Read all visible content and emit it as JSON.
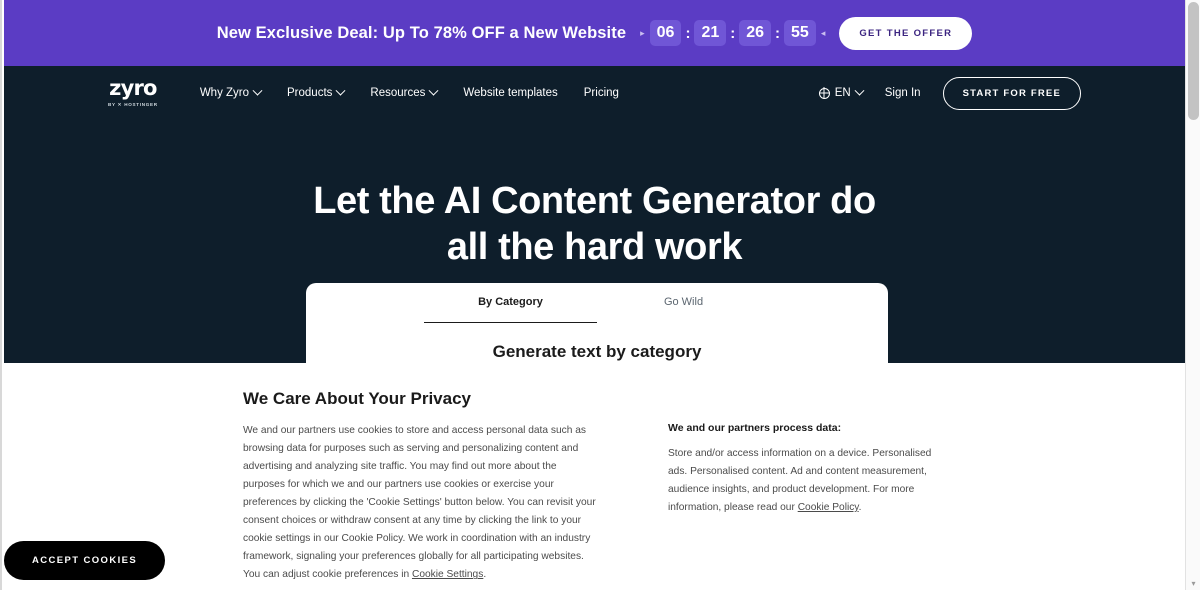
{
  "promo": {
    "text": "New Exclusive Deal: Up To 78% OFF a New Website",
    "timer": {
      "days": "06",
      "hours": "21",
      "minutes": "26",
      "seconds": "55",
      "separator": ":"
    },
    "arrow_left": "▸",
    "arrow_right": "◂",
    "cta_label": "GET THE OFFER",
    "bg_color": "#5b3cc4",
    "cell_color": "#7056d6"
  },
  "navbar": {
    "logo": {
      "word": "zyro",
      "sub": "BY ✕ HOSTINGER"
    },
    "links": [
      {
        "label": "Why Zyro",
        "has_chevron": true
      },
      {
        "label": "Products",
        "has_chevron": true
      },
      {
        "label": "Resources",
        "has_chevron": true
      },
      {
        "label": "Website templates",
        "has_chevron": false
      },
      {
        "label": "Pricing",
        "has_chevron": false
      }
    ],
    "language": "EN",
    "sign_in": "Sign In",
    "start_free": "START FOR FREE",
    "bg_color": "#0e1e2b"
  },
  "hero": {
    "headline_line1": "Let the AI Content Generator do",
    "headline_line2": "all the hard work"
  },
  "generator": {
    "tabs": [
      {
        "label": "By Category",
        "active": true
      },
      {
        "label": "Go Wild",
        "active": false
      }
    ],
    "heading": "Generate text by category"
  },
  "cookie_banner": {
    "title": "We Care About Your Privacy",
    "body": "We and our partners use cookies to store and access personal data such as browsing data for purposes such as serving and personalizing content and advertising and analyzing site traffic. You may find out more about the purposes for which we and our partners use cookies or exercise your preferences by clicking the 'Cookie Settings' button below. You can revisit your consent choices or withdraw consent at any time by clicking the link to your cookie settings in our Cookie Policy. We work in coordination with an industry framework, signaling your preferences globally for all participating websites. You can adjust cookie preferences in ",
    "body_link": "Cookie Settings",
    "body_end": ".",
    "partners_title": "We and our partners process data:",
    "partners_body": "Store and/or access information on a device. Personalised ads. Personalised content. Ad and content measurement, audience insights, and product development. For more information, please read our ",
    "partners_link": "Cookie Policy",
    "partners_end": ".",
    "accept_label": "ACCEPT COOKIES"
  },
  "browser": {
    "scroll_down_arrow": "▾"
  }
}
